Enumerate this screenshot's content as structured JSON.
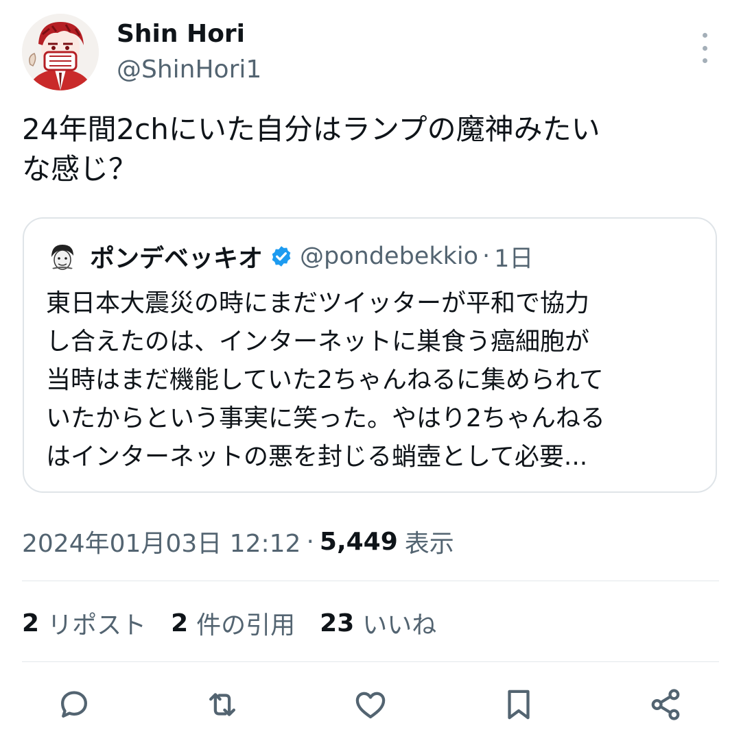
{
  "author": {
    "display_name": "Shin Hori",
    "handle": "@ShinHori1",
    "avatar_icon": "avatar-illustration-icon"
  },
  "more_icon": "more-vertical-icon",
  "tweet": {
    "text_lines": [
      "24年間2chにいた自分はランプの魔神みたい",
      "な感じ？"
    ]
  },
  "quote": {
    "display_name": "ポンデベッキオ",
    "verified_icon": "verified-badge-icon",
    "verified_color": "#1d9bf0",
    "handle": "@pondebekkio",
    "separator": "·",
    "time": "1日",
    "text_lines": [
      "東日本大震災の時にまだツイッターが平和で協力",
      "し合えたのは、インターネットに巣食う癌細胞が",
      "当時はまだ機能していた2ちゃんねるに集められて",
      "いたからという事実に笑った。やはり2ちゃんねる",
      "はインターネットの悪を封じる蛸壺として必要..."
    ]
  },
  "meta": {
    "timestamp": "2024年01月03日 12:12",
    "separator": "·",
    "views_count": "5,449",
    "views_label": "表示"
  },
  "stats": [
    {
      "count": "2",
      "label": "リポスト"
    },
    {
      "count": "2",
      "label": "件の引用"
    },
    {
      "count": "23",
      "label": "いいね"
    }
  ],
  "actions": [
    {
      "icon": "reply-icon"
    },
    {
      "icon": "retweet-icon"
    },
    {
      "icon": "like-icon"
    },
    {
      "icon": "bookmark-icon"
    },
    {
      "icon": "share-icon"
    }
  ],
  "colors": {
    "text": "#0f1419",
    "muted": "#536471",
    "border": "#dfe4e8",
    "verified": "#1d9bf0"
  }
}
